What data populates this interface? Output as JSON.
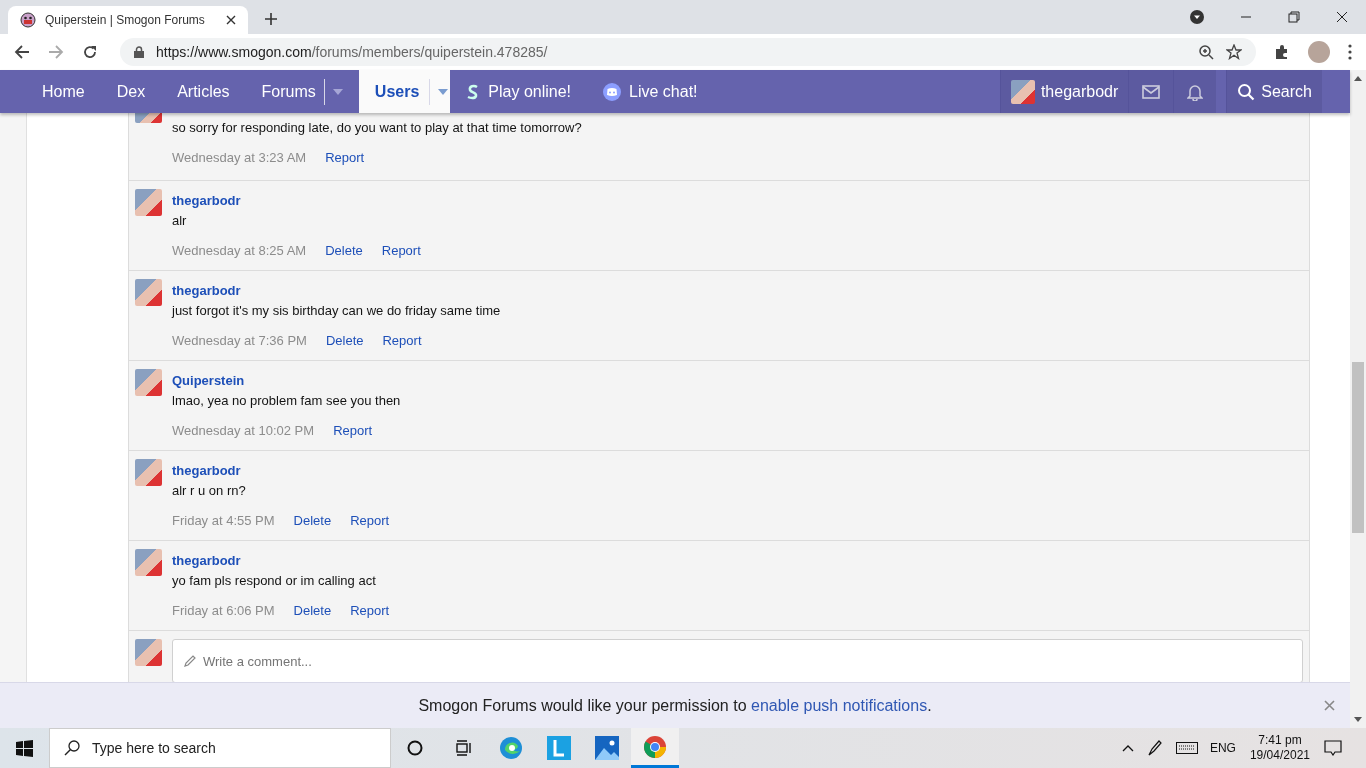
{
  "browser": {
    "tab_title": "Quiperstein | Smogon Forums",
    "url_host": "https://www.smogon.com",
    "url_path": "/forums/members/quiperstein.478285/"
  },
  "nav": {
    "items": [
      {
        "label": "Home",
        "selected": false,
        "kind": "link"
      },
      {
        "label": "Dex",
        "selected": false,
        "kind": "link"
      },
      {
        "label": "Articles",
        "selected": false,
        "kind": "link"
      },
      {
        "label": "Forums",
        "selected": false,
        "kind": "dropdown"
      },
      {
        "label": "Users",
        "selected": true,
        "kind": "dropdown"
      },
      {
        "label": "Play online!",
        "selected": false,
        "kind": "play"
      },
      {
        "label": "Live chat!",
        "selected": false,
        "kind": "chat"
      }
    ],
    "user": "thegarbodr",
    "search": "Search"
  },
  "comments": [
    {
      "text": "so sorry for responding late, do you want to play at that time tomorrow?",
      "time": "Wednesday at 3:23 AM",
      "actions": [
        "Report"
      ]
    },
    {
      "author": "thegarbodr",
      "text": "alr",
      "time": "Wednesday at 8:25 AM",
      "actions": [
        "Delete",
        "Report"
      ]
    },
    {
      "author": "thegarbodr",
      "text": "just forgot it's my sis birthday can we do friday same time",
      "time": "Wednesday at 7:36 PM",
      "actions": [
        "Delete",
        "Report"
      ]
    },
    {
      "author": "Quiperstein",
      "text": "lmao, yea no problem fam see you then",
      "time": "Wednesday at 10:02 PM",
      "actions": [
        "Report"
      ]
    },
    {
      "author": "thegarbodr",
      "text": "alr r u on rn?",
      "time": "Friday at 4:55 PM",
      "actions": [
        "Delete",
        "Report"
      ]
    },
    {
      "author": "thegarbodr",
      "text": "yo fam pls respond or im calling act",
      "time": "Friday at 6:06 PM",
      "actions": [
        "Delete",
        "Report"
      ]
    }
  ],
  "comment_box": {
    "placeholder": "Write a comment..."
  },
  "notice": {
    "text": "Smogon Forums would like your permission to ",
    "link": "enable push notifications",
    "end": "."
  },
  "taskbar": {
    "search_placeholder": "Type here to search",
    "language": "ENG",
    "time": "7:41 pm",
    "date": "19/04/2021"
  }
}
